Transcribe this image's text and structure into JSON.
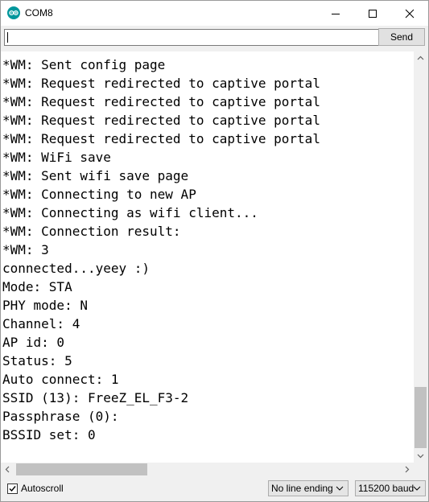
{
  "window": {
    "title": "COM8",
    "app_icon": "arduino-icon",
    "controls": {
      "minimize_icon": "minimize-icon",
      "maximize_icon": "maximize-icon",
      "close_icon": "close-icon"
    }
  },
  "send_row": {
    "input_value": "",
    "send_label": "Send"
  },
  "output": {
    "lines": [
      "*WM: Sent config page",
      "*WM: Request redirected to captive portal",
      "*WM: Request redirected to captive portal",
      "*WM: Request redirected to captive portal",
      "*WM: Request redirected to captive portal",
      "*WM: WiFi save",
      "*WM: Sent wifi save page",
      "*WM: Connecting to new AP",
      "*WM: Connecting as wifi client...",
      "*WM: Connection result:",
      "*WM: 3",
      "connected...yeey :)",
      "Mode: STA",
      "PHY mode: N",
      "Channel: 4",
      "AP id: 0",
      "Status: 5",
      "Auto connect: 1",
      "SSID (13): FreeZ_EL_F3-2",
      "Passphrase (0):",
      "BSSID set: 0"
    ]
  },
  "footer": {
    "autoscroll_label": "Autoscroll",
    "autoscroll_checked": true,
    "line_ending": "No line ending",
    "baud_rate": "115200 baud"
  },
  "colors": {
    "arduino_teal": "#00979c",
    "scroll_thumb": "#c1c1c1",
    "chrome_bg": "#f0f0f0"
  }
}
